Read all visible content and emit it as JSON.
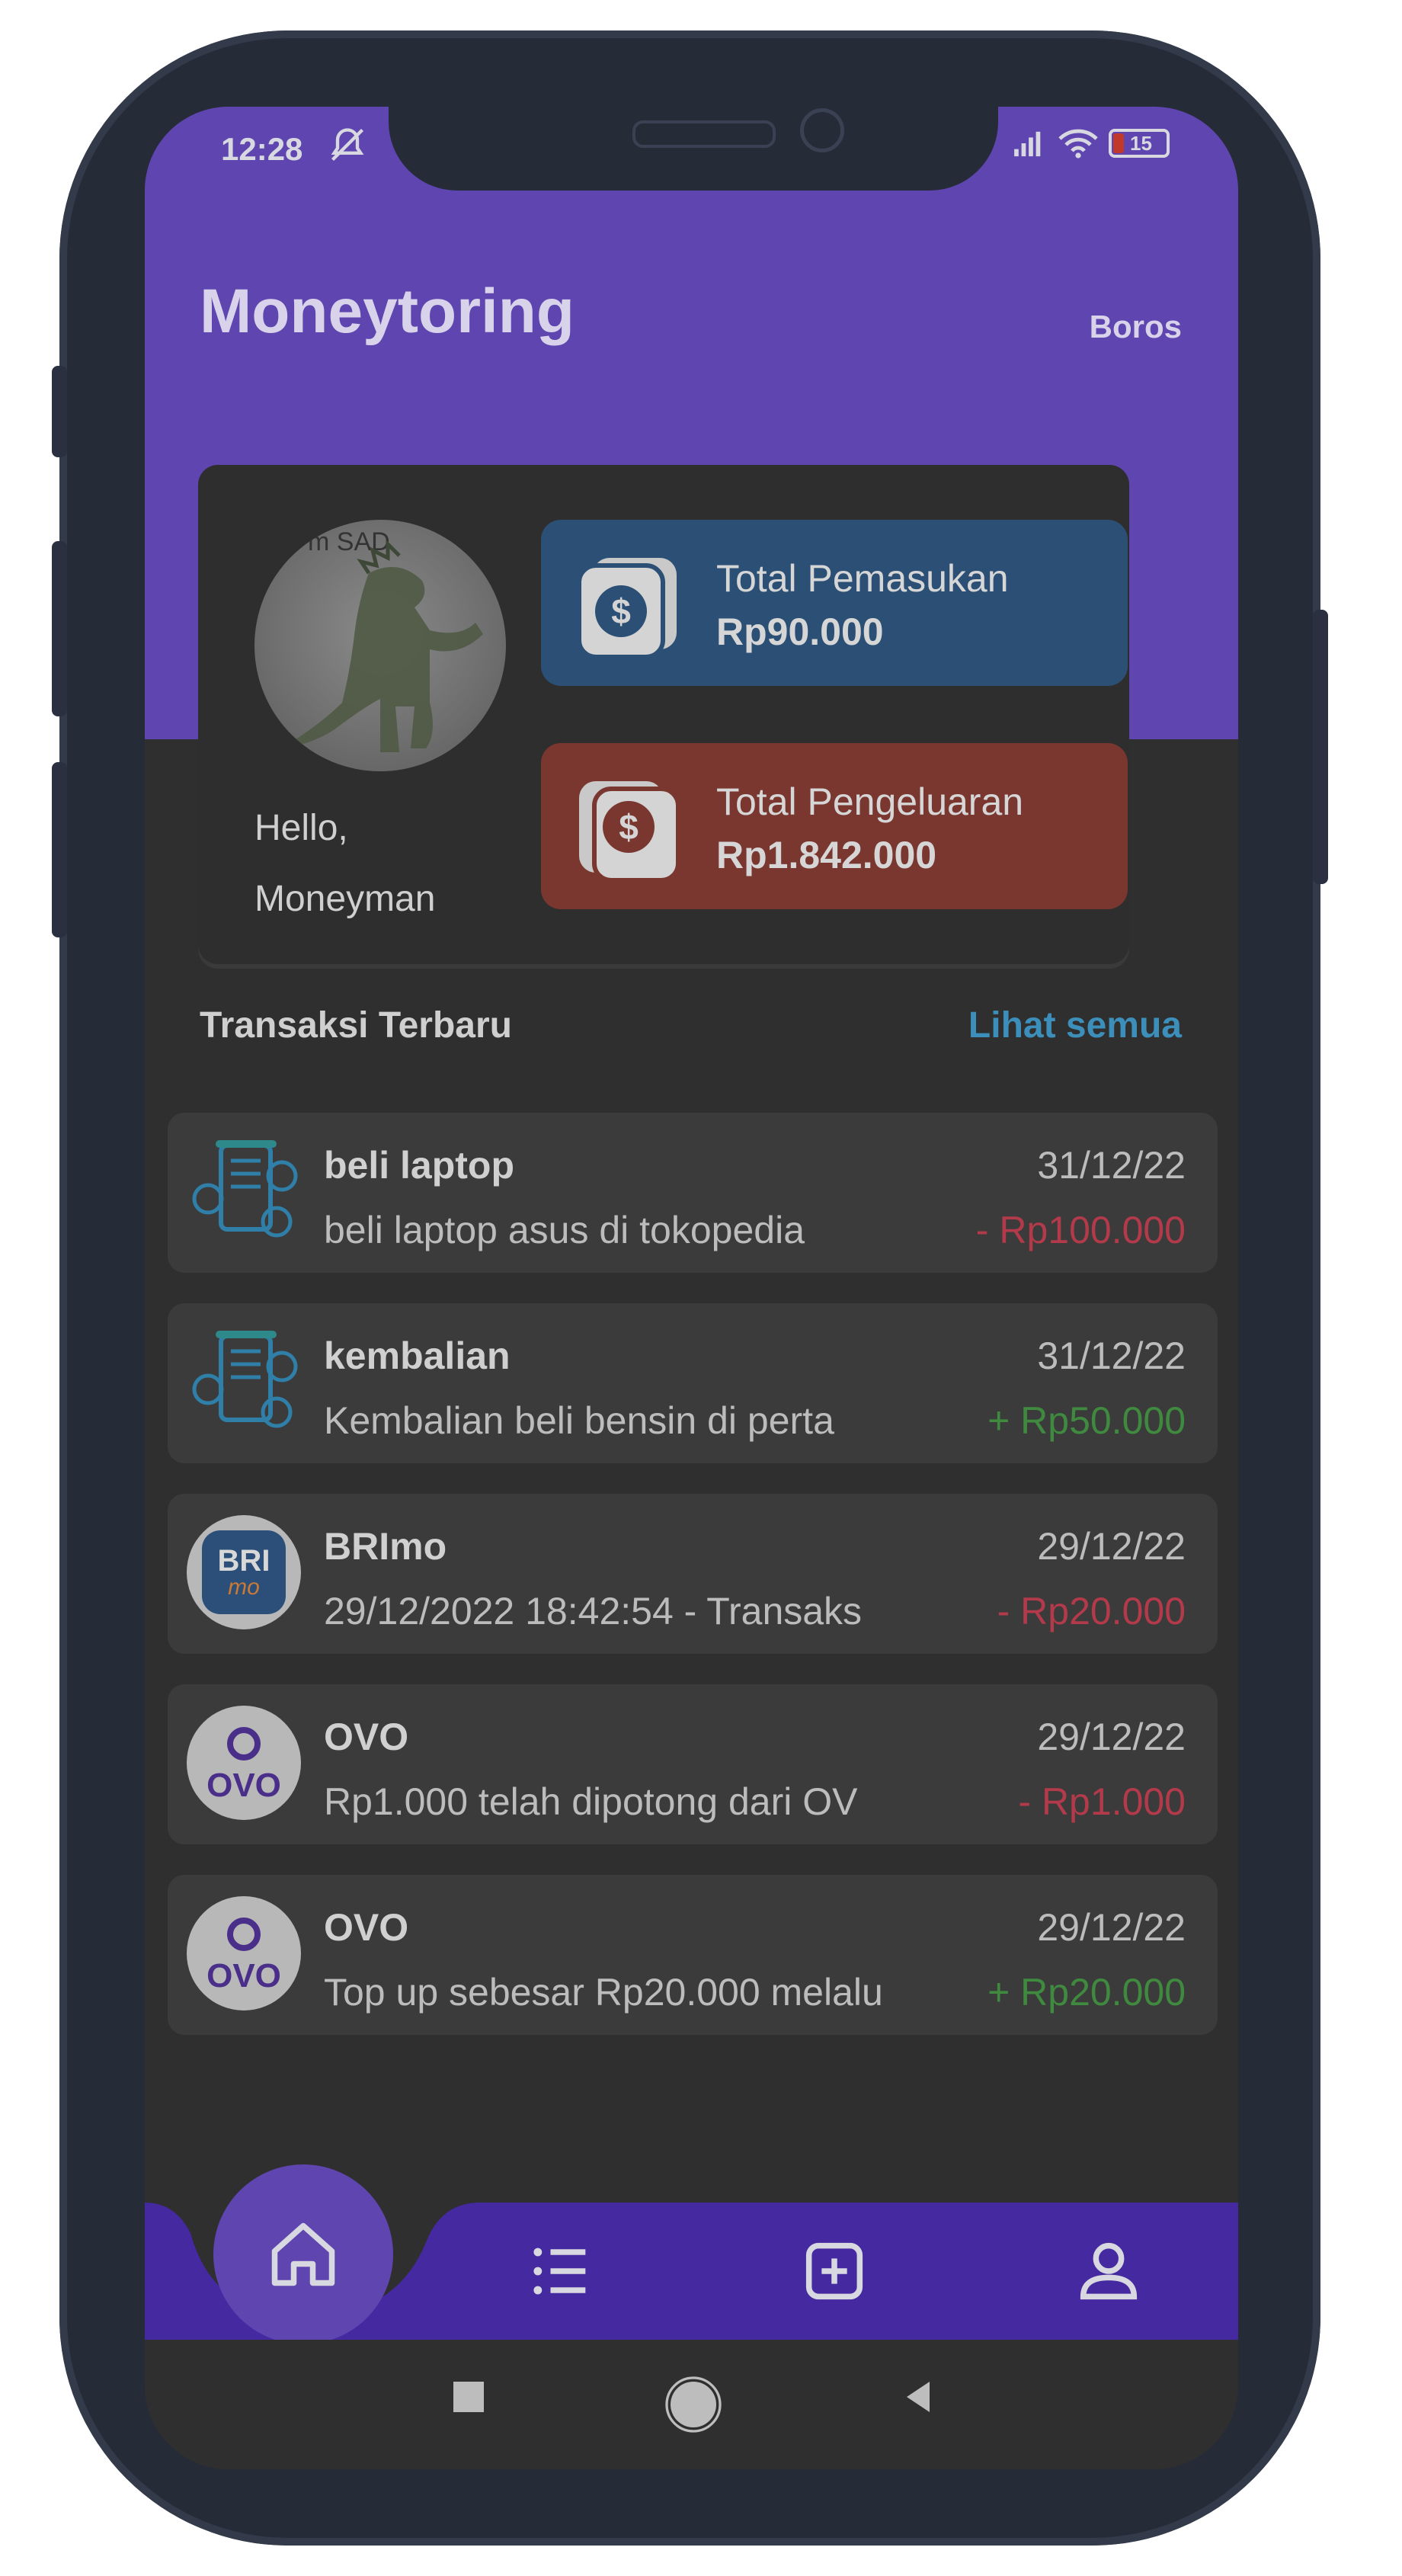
{
  "status_bar": {
    "time": "12:28",
    "battery": "15"
  },
  "header": {
    "app_title": "Moneytoring",
    "status_chip": "Boros"
  },
  "profile": {
    "avatar_caption": "m SAD",
    "greeting_line1": "Hello,",
    "greeting_line2": "Moneyman"
  },
  "summary": {
    "income": {
      "label": "Total Pemasukan",
      "value": "Rp90.000",
      "color": "#2c5075"
    },
    "expense": {
      "label": "Total Pengeluaran",
      "value": "Rp1.842.000",
      "color": "#7a3730"
    }
  },
  "section": {
    "title": "Transaksi Terbaru",
    "link": "Lihat semua"
  },
  "transactions": [
    {
      "icon": "money-document-icon",
      "title": "beli laptop",
      "desc": "beli laptop  asus di tokopedia",
      "date": "31/12/22",
      "amount": "- Rp100.000",
      "type": "expense"
    },
    {
      "icon": "money-document-icon",
      "title": "kembalian",
      "desc": "Kembalian beli bensin di perta",
      "date": "31/12/22",
      "amount": "+ Rp50.000",
      "type": "income"
    },
    {
      "icon": "brimo-logo-icon",
      "title": "BRImo",
      "desc": "29/12/2022 18:42:54 - Transaks",
      "date": "29/12/22",
      "amount": "- Rp20.000",
      "type": "expense"
    },
    {
      "icon": "ovo-logo-icon",
      "title": "OVO",
      "desc": "Rp1.000 telah dipotong dari OV",
      "date": "29/12/22",
      "amount": "- Rp1.000",
      "type": "expense"
    },
    {
      "icon": "ovo-logo-icon",
      "title": "OVO",
      "desc": "Top up sebesar Rp20.000 melalu",
      "date": "29/12/22",
      "amount": "+ Rp20.000",
      "type": "income"
    }
  ],
  "logos": {
    "brimo_top": "BRI",
    "brimo_bottom": "mo",
    "ovo": "OVO"
  },
  "nav": [
    "home-icon",
    "list-icon",
    "add-icon",
    "profile-icon"
  ],
  "colors": {
    "accent": "#5f45b0",
    "nav": "#4429a0",
    "link": "#3c8fba",
    "negative": "#b23a4a",
    "positive": "#3f8a3f"
  }
}
